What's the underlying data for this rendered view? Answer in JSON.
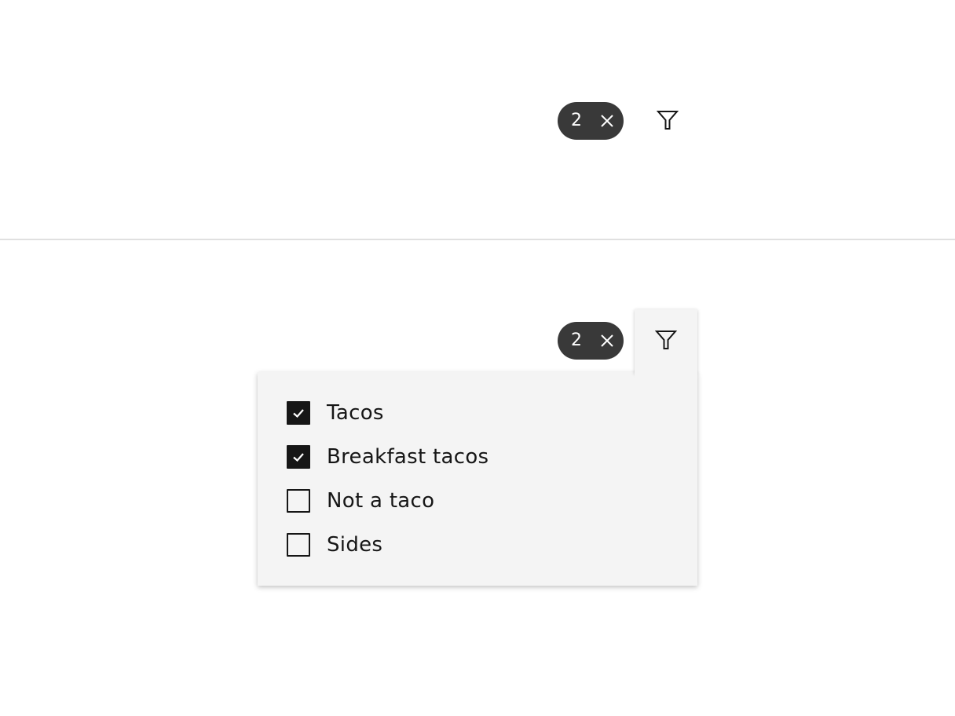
{
  "closed_state": {
    "tag": {
      "count": "2",
      "close_icon": "close-icon"
    },
    "filter_icon": "filter-icon"
  },
  "open_state": {
    "tag": {
      "count": "2",
      "close_icon": "close-icon"
    },
    "filter_icon": "filter-icon",
    "options": [
      {
        "label": "Tacos",
        "checked": true
      },
      {
        "label": "Breakfast tacos",
        "checked": true
      },
      {
        "label": "Not a taco",
        "checked": false
      },
      {
        "label": "Sides",
        "checked": false
      }
    ]
  },
  "colors": {
    "tag_bg": "#393939",
    "flyout_bg": "#f4f4f4",
    "text": "#161616",
    "divider": "#e0e0e0"
  }
}
